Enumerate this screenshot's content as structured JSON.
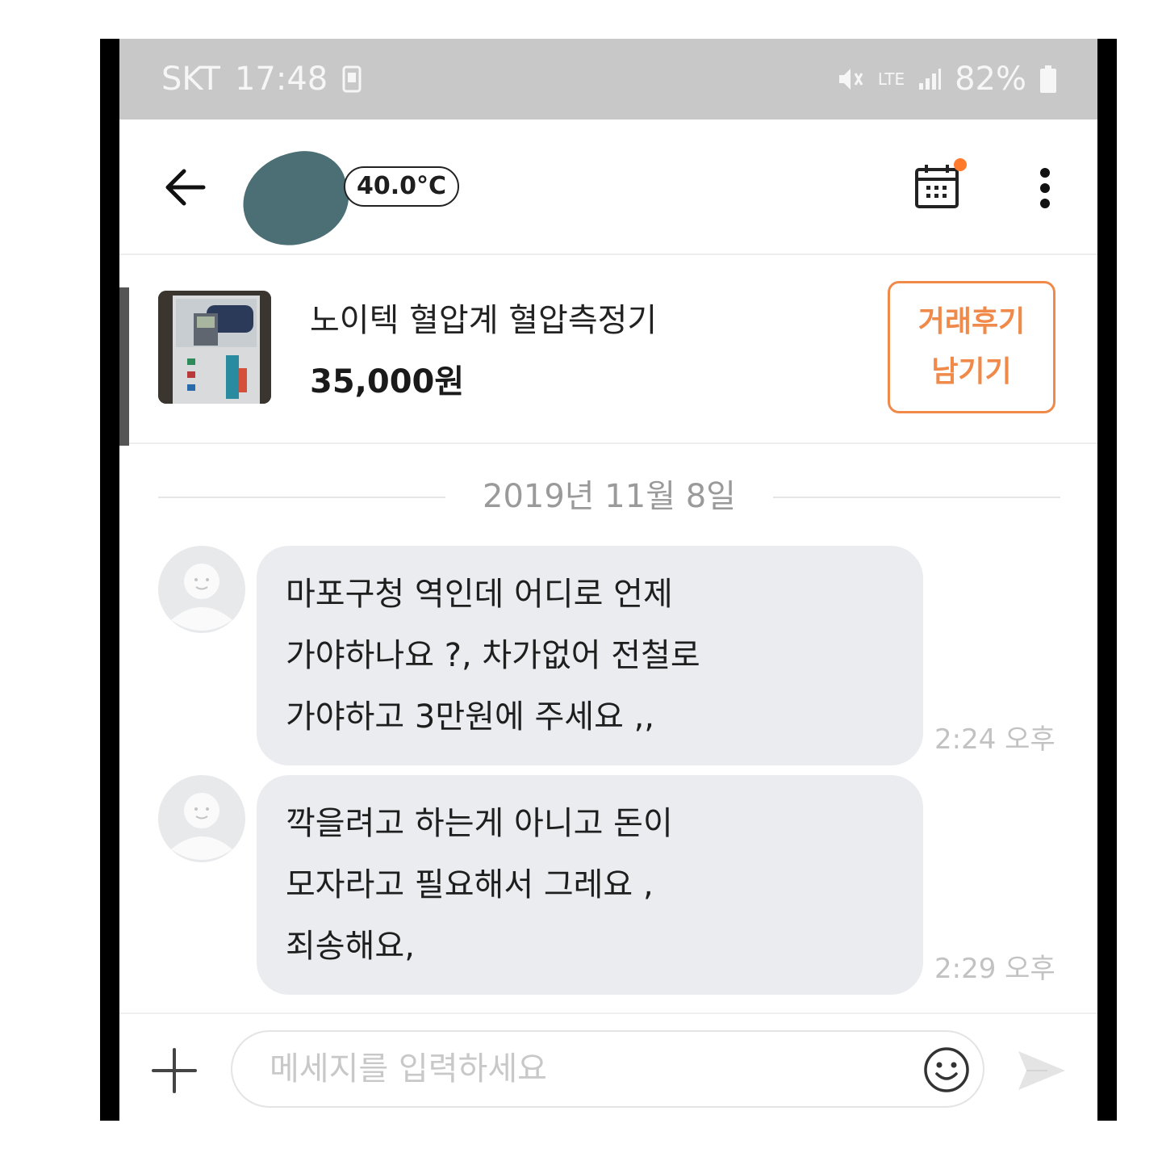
{
  "status_bar": {
    "carrier": "SKT",
    "time": "17:48",
    "network": "LTE",
    "battery": "82%"
  },
  "header": {
    "temperature": "40.0°C"
  },
  "product": {
    "title": "노이텍 혈압계 혈압측정기",
    "price": "35,000원",
    "review_button": {
      "line1": "거래후기",
      "line2": "남기기"
    }
  },
  "chat": {
    "date": "2019년 11월 8일",
    "messages": [
      {
        "lines": [
          "마포구청 역인데  어디로 언제",
          "가야하나요 ?, 차가없어 전철로",
          "가야하고 3만원에 주세요 ,,"
        ],
        "time": "2:24 오후"
      },
      {
        "lines": [
          "깍을려고 하는게 아니고  돈이",
          "모자라고  필요해서 그레요 ,",
          "죄송해요,"
        ],
        "time": "2:29 오후"
      }
    ]
  },
  "input": {
    "placeholder": "메세지를 입력하세요"
  },
  "colors": {
    "accent": "#f08a4b",
    "notification_dot": "#ff7a2a",
    "bubble_bg": "#eaecef",
    "status_bar_bg": "#c8c8c8"
  },
  "icons": [
    "back-arrow-icon",
    "calendar-icon",
    "more-vertical-icon",
    "plus-icon",
    "emoji-icon",
    "send-icon",
    "mute-icon",
    "signal-icon",
    "battery-icon"
  ]
}
